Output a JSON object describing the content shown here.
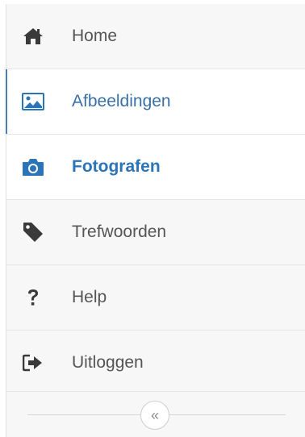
{
  "sidebar": {
    "items": [
      {
        "label": "Home",
        "icon": "home-icon"
      },
      {
        "label": "Afbeeldingen",
        "icon": "image-icon"
      },
      {
        "label": "Fotografen",
        "icon": "camera-icon"
      },
      {
        "label": "Trefwoorden",
        "icon": "tag-icon"
      },
      {
        "label": "Help",
        "icon": "question-icon"
      },
      {
        "label": "Uitloggen",
        "icon": "sign-out-icon"
      }
    ],
    "collapse_glyph": "«"
  },
  "colors": {
    "accent": "#2b74b8",
    "text": "#555555",
    "icon_dark": "#3a3a3a",
    "background": "#f7f7f7"
  }
}
